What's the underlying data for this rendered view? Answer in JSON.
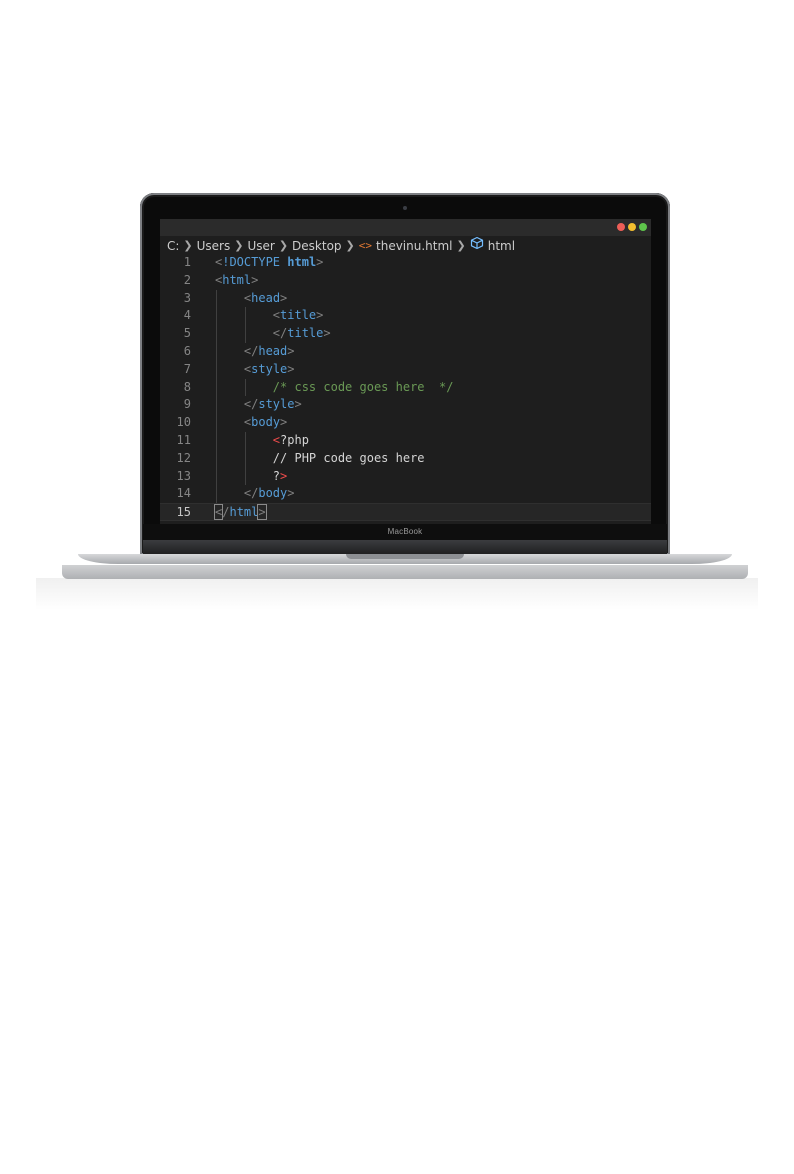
{
  "device": {
    "brand": "MacBook"
  },
  "window": {
    "controls": [
      "close",
      "minimize",
      "maximize"
    ]
  },
  "breadcrumb": {
    "items": [
      "C:",
      "Users",
      "User",
      "Desktop",
      "thevinu.html",
      "html"
    ],
    "file_icon": "code-brackets-icon",
    "symbol_icon": "cube-icon"
  },
  "editor": {
    "lines": [
      {
        "n": "1",
        "segs": [
          [
            "p",
            "<"
          ],
          [
            "t",
            "!DOCTYPE "
          ],
          [
            "b",
            "html"
          ],
          [
            "p",
            ">"
          ]
        ]
      },
      {
        "n": "2",
        "segs": [
          [
            "p",
            "<"
          ],
          [
            "t",
            "html"
          ],
          [
            "p",
            ">"
          ]
        ]
      },
      {
        "n": "3",
        "segs": [
          [
            "w",
            "    "
          ],
          [
            "p",
            "<"
          ],
          [
            "t",
            "head"
          ],
          [
            "p",
            ">"
          ]
        ]
      },
      {
        "n": "4",
        "segs": [
          [
            "w",
            "        "
          ],
          [
            "p",
            "<"
          ],
          [
            "t",
            "title"
          ],
          [
            "p",
            ">"
          ]
        ]
      },
      {
        "n": "5",
        "segs": [
          [
            "w",
            "        "
          ],
          [
            "p",
            "</"
          ],
          [
            "t",
            "title"
          ],
          [
            "p",
            ">"
          ]
        ]
      },
      {
        "n": "6",
        "segs": [
          [
            "w",
            "    "
          ],
          [
            "p",
            "</"
          ],
          [
            "t",
            "head"
          ],
          [
            "p",
            ">"
          ]
        ]
      },
      {
        "n": "7",
        "segs": [
          [
            "w",
            "    "
          ],
          [
            "p",
            "<"
          ],
          [
            "t",
            "style"
          ],
          [
            "p",
            ">"
          ]
        ]
      },
      {
        "n": "8",
        "segs": [
          [
            "w",
            "        "
          ],
          [
            "c",
            "/* css code goes here  */"
          ]
        ]
      },
      {
        "n": "9",
        "segs": [
          [
            "w",
            "    "
          ],
          [
            "p",
            "</"
          ],
          [
            "t",
            "style"
          ],
          [
            "p",
            ">"
          ]
        ]
      },
      {
        "n": "10",
        "segs": [
          [
            "w",
            "    "
          ],
          [
            "p",
            "<"
          ],
          [
            "t",
            "body"
          ],
          [
            "p",
            ">"
          ]
        ]
      },
      {
        "n": "11",
        "segs": [
          [
            "w",
            "        "
          ],
          [
            "r",
            "<"
          ],
          [
            "w",
            "?php"
          ]
        ]
      },
      {
        "n": "12",
        "segs": [
          [
            "w",
            "        // PHP code goes here"
          ]
        ]
      },
      {
        "n": "13",
        "segs": [
          [
            "w",
            "        ?"
          ],
          [
            "r",
            ">"
          ]
        ]
      },
      {
        "n": "14",
        "segs": [
          [
            "w",
            "    "
          ],
          [
            "p",
            "</"
          ],
          [
            "t",
            "body"
          ],
          [
            "p",
            ">"
          ]
        ]
      },
      {
        "n": "15",
        "segs": [
          [
            "hl",
            "<"
          ],
          [
            "p",
            "/"
          ],
          [
            "t",
            "html"
          ],
          [
            "hl",
            ">"
          ]
        ],
        "active": true
      }
    ]
  },
  "colors": {
    "editor_bg": "#1e1e1e",
    "tag": "#569cd6",
    "comment": "#6a9955",
    "php_bracket": "#f14c4c",
    "file_icon": "#e37933"
  }
}
